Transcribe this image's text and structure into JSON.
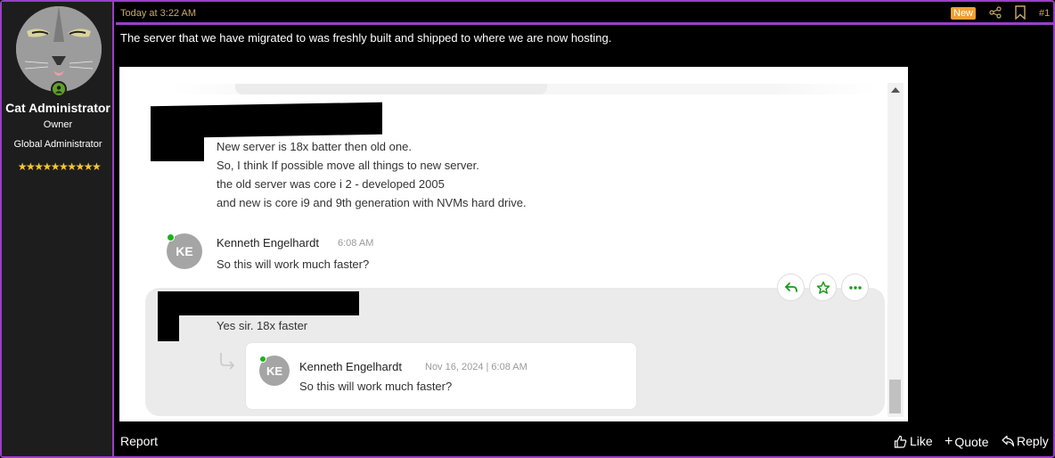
{
  "user": {
    "name": "Cat Administrator",
    "title": "Owner",
    "role": "Global Administrator",
    "stars": "★★★★★★★★★★",
    "status": "online"
  },
  "post": {
    "timestamp": "Today at 3:22 AM",
    "new_badge": "New",
    "number": "#1",
    "body": "The server that we have migrated to was freshly built and shipped to where we are now hosting.",
    "colors": {
      "accent": "#9b3fc8",
      "meta": "#c9a96a",
      "badge": "#f0a030"
    }
  },
  "screenshot": {
    "messages": [
      {
        "lines": [
          "New server is 18x batter then old one.",
          "So, I think If possible move all things to new server.",
          "the old server was core i 2 - developed 2005",
          "and new is core i9 and 9th generation with NVMs hard drive."
        ]
      },
      {
        "initials": "KE",
        "sender": "Kenneth Engelhardt",
        "time": "6:08 AM",
        "text": "So this will work much faster?"
      },
      {
        "text": "Yes sir. 18x faster",
        "quoted": {
          "initials": "KE",
          "sender": "Kenneth Engelhardt",
          "time": "Nov 16, 2024 | 6:08 AM",
          "text": "So this will work much faster?"
        }
      }
    ],
    "actions": [
      "reply",
      "react",
      "more"
    ],
    "accent": "#1a9a1a"
  },
  "footer": {
    "report": "Report",
    "like": "Like",
    "quote": "Quote",
    "reply": "Reply"
  }
}
